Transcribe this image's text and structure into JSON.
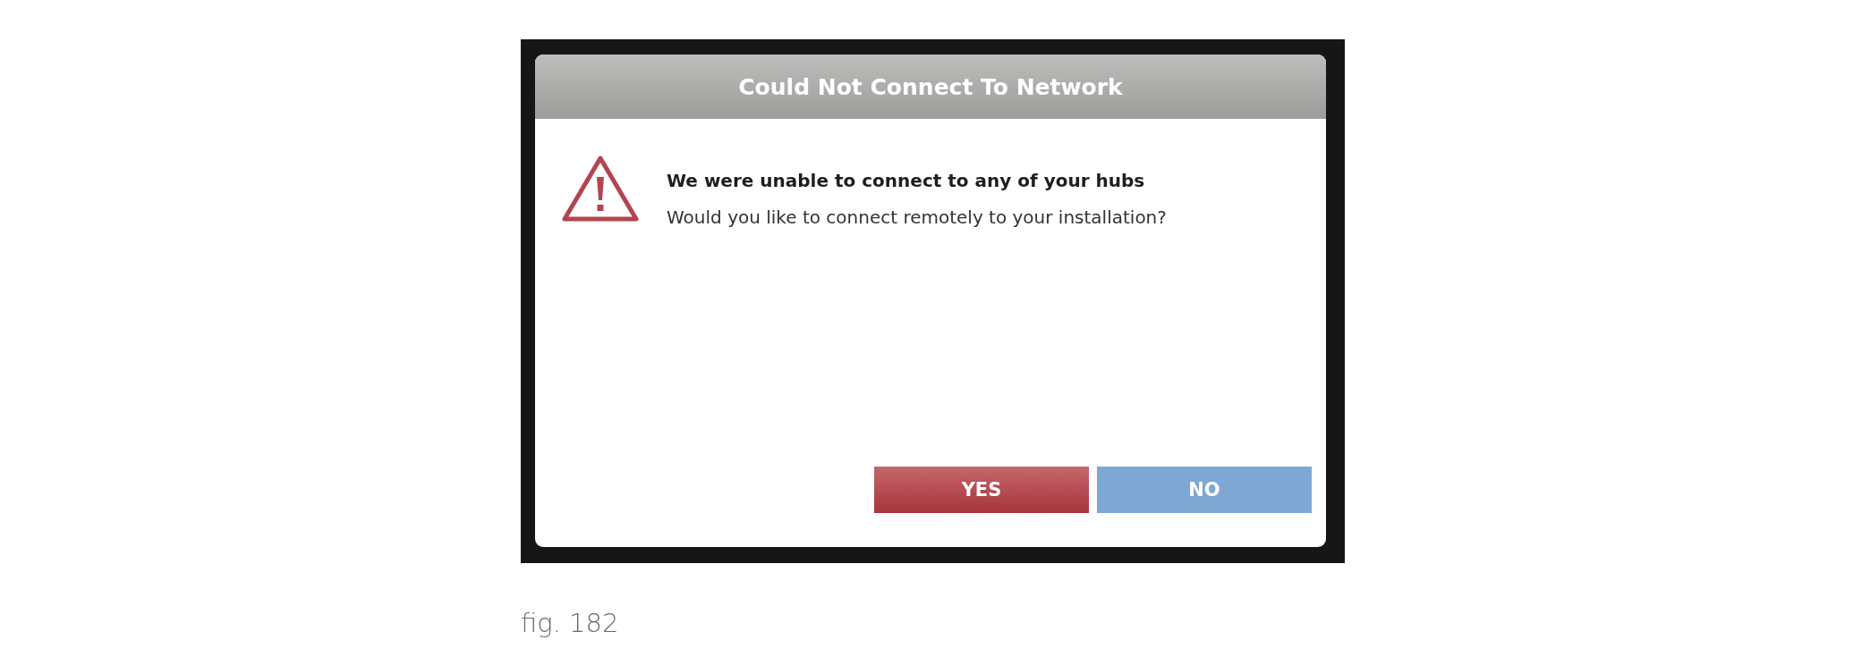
{
  "dialog": {
    "title": "Could Not Connect To Network",
    "heading": "We were unable to connect to any of your hubs",
    "message": "Would you like to connect remotely to your installation?",
    "buttons": [
      {
        "label": "YES",
        "kind": "confirm"
      },
      {
        "label": "NO",
        "kind": "cancel"
      }
    ]
  },
  "caption": "fig. 182"
}
